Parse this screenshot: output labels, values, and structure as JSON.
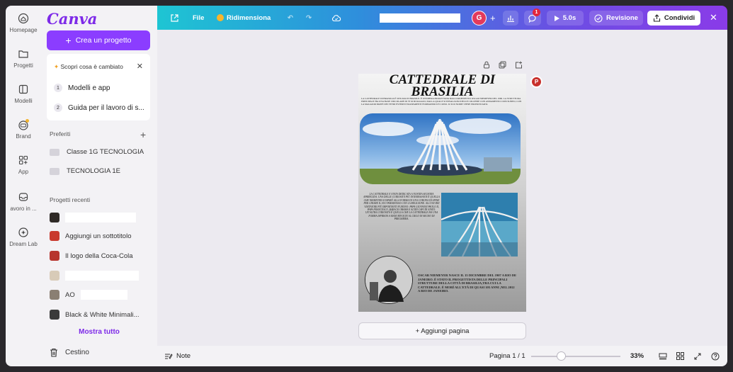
{
  "rail": [
    {
      "id": "home",
      "label": "Homepage",
      "icon": "home-icon"
    },
    {
      "id": "projects",
      "label": "Progetti",
      "icon": "folder-icon"
    },
    {
      "id": "templates",
      "label": "Modelli",
      "icon": "templates-icon"
    },
    {
      "id": "brand",
      "label": "Brand",
      "icon": "brand-icon"
    },
    {
      "id": "apps",
      "label": "App",
      "icon": "apps-icon"
    },
    {
      "id": "work",
      "label": "avoro in ...",
      "icon": "inbox-icon"
    },
    {
      "id": "dreamlab",
      "label": "Dream Lab",
      "icon": "dream-lab-icon"
    }
  ],
  "sidebar": {
    "logo": "Canva",
    "create_label": "Crea un progetto",
    "whats_new": {
      "title": "Scopri cosa è cambiato",
      "items": [
        {
          "num": "1",
          "label": "Modelli e app"
        },
        {
          "num": "2",
          "label": "Guida per il lavoro di s..."
        }
      ]
    },
    "favorites_title": "Preferiti",
    "favorites": [
      "Classe 1G TECNOLOGIA",
      "TECNOLOGIA 1E"
    ],
    "recent_title": "Progetti recenti",
    "recent": [
      {
        "label": "",
        "thumb": "#2f2a27"
      },
      {
        "label": "Aggiungi un sottotitolo",
        "thumb": "#c93a2e"
      },
      {
        "label": "Il logo della Coca-Cola",
        "thumb": "#b7352e"
      },
      {
        "label": "",
        "thumb": "#d8cbb8"
      },
      {
        "label": "AO",
        "thumb": "#8a7f73"
      },
      {
        "label": "Black & White Minimali...",
        "thumb": "#3a3a3a"
      }
    ],
    "show_all": "Mostra tutto",
    "trash": "Cestino"
  },
  "topbar": {
    "file": "File",
    "resize": "Ridimensiona",
    "avatar": "G",
    "notif_count": "1",
    "play_time": "5.0s",
    "review": "Revisione",
    "share": "Condividi"
  },
  "page": {
    "title": "CATTEDRALE DI BRASILIA",
    "intro": "LA CATTEDRALE DI BRASILIA È SITUATA IN BRASILE. È UN'OPERA PROGETTATA DALL'ARCHITETTO OSCAR NIEMEYER DEL 1960. LA STRUTTURA PRINCIPALE HA UNA BASE CIRCOLARE DI 70 M DI RAGGIO, DALLA QUALE SI INNALZANO DELLE COLONNE CON ANDAMENTO CURVILINEO, CON LA MAGGIOR PARTE DEI VETRI ESTERNI TRASPARENTI FORMANDO UN CONO. IL SUO NOME VIENE PRONUNCIATO.",
    "middle": "LA CATTEDRALE È STATA DEDICATA A NOSTRA SIGNORA APARECIDA. UNA DELLE CURIOSITÀ PIÙ INTERESSANTI È QUELLA CHE NIEMEYER SI ISPIRÒ ALLA FORMA DI UNA CORONA DI SPINE PER CHIARE IL SUO PARADOSSO CON LA RELIGIONE. ALCUNI DEI VISITATORI PIÙ IMPORTANTI FURONO: PAPA GIOVANNI PAOLO II, PAPA FRANCESCO, BARACK OBAMA E ALTRI CAPI DI STATO. UN'ALTRA CURIOSITÀ È QUELLA CHE LA CATTEDRALE HA UNA FORMA ISPIRATA A MANI RIVOLTE AL CIELO IN SEGNO DI PREGHIERA.",
    "bio": "OSCAR NIEMEYER NASCE IL 15 DICEMBRE DEL 1907 A RIO DE JANEIRO. È STATO IL PROGETTISTA DELLE PRINCIPALI STRUTTURE DELLA CITTÀ DI BRASILIA,TRA CUI LA CATTEDRALE. È MORÌ ALL'ETÀ DI QUASI 105 ANNI ,NEL 2012 A RIO DE JANEIRO.",
    "collab_avatar": "P"
  },
  "add_page": "+ Aggiungi pagina",
  "bottombar": {
    "notes": "Note",
    "page_indicator": "Pagina 1 / 1",
    "zoom": "33%",
    "zoom_fraction": 0.33
  },
  "colors": {
    "accent": "#8b3dff",
    "danger": "#e23a5c"
  }
}
